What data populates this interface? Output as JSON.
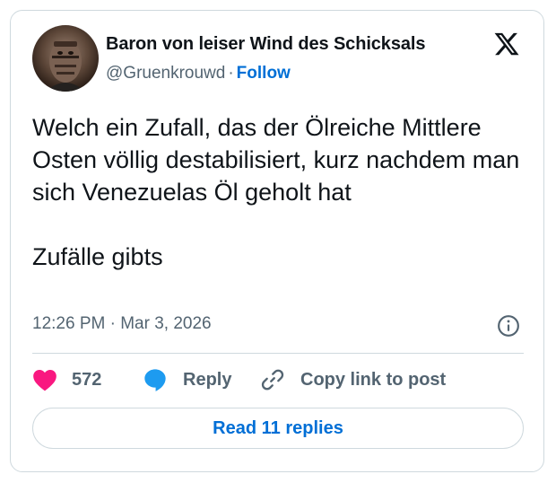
{
  "author": {
    "display_name": "Baron von leiser Wind des Schicksals",
    "handle": "@Gruenkrouwd",
    "separator": "·",
    "follow_label": "Follow"
  },
  "tweet": {
    "paragraphs": [
      "Welch ein Zufall, das der Ölreiche Mittlere Osten völlig destabilisiert, kurz nachdem man sich Venezuelas Öl geholt hat",
      "Zufälle gibts"
    ],
    "timestamp": "12:26 PM · Mar 3, 2026"
  },
  "actions": {
    "like_count": "572",
    "reply_label": "Reply",
    "copy_label": "Copy link to post"
  },
  "read_replies_label": "Read 11 replies",
  "icons": {
    "logo": "x-logo-icon",
    "info": "info-icon",
    "like": "heart-icon",
    "reply": "reply-bubble-icon",
    "copy": "link-icon"
  },
  "colors": {
    "text": "#0f1419",
    "secondary": "#536471",
    "link": "#006fd6",
    "heart": "#f91880",
    "reply_bubble": "#1d9bf0",
    "border": "#cfd9de"
  }
}
